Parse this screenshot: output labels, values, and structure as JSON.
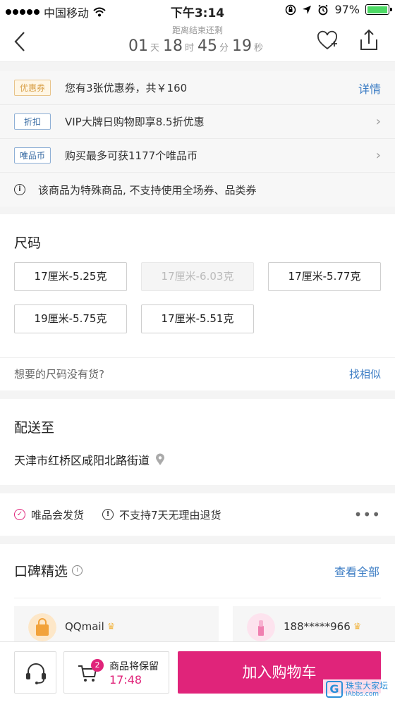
{
  "status_bar": {
    "carrier": "中国移动",
    "time": "下午3:14",
    "battery": "97%",
    "battery_level": 0.97
  },
  "nav": {
    "countdown_label": "距离结束还剩",
    "days": "01",
    "days_unit": "天",
    "hours": "18",
    "hours_unit": "时",
    "minutes": "45",
    "minutes_unit": "分",
    "seconds": "19",
    "seconds_unit": "秒"
  },
  "promotions": {
    "coupon_tag": "优惠券",
    "coupon_text": "您有3张优惠券，共￥160",
    "coupon_link": "详情",
    "discount_tag": "折扣",
    "discount_text": "VIP大牌日购物即享8.5折优惠",
    "coin_tag": "唯品币",
    "coin_text": "购买最多可获1177个唯品币",
    "notice_text": "该商品为特殊商品, 不支持使用全场券、品类券"
  },
  "size": {
    "title": "尺码",
    "options": [
      {
        "label": "17厘米-5.25克",
        "available": true
      },
      {
        "label": "17厘米-6.03克",
        "available": false
      },
      {
        "label": "17厘米-5.77克",
        "available": true
      },
      {
        "label": "19厘米-5.75克",
        "available": true
      },
      {
        "label": "17厘米-5.51克",
        "available": true
      }
    ],
    "want_text": "想要的尺码没有货?",
    "similar_link": "找相似"
  },
  "delivery": {
    "title": "配送至",
    "address": "天津市红桥区咸阳北路街道"
  },
  "service": {
    "ship_text": "唯品会发货",
    "return_text": "不支持7天无理由退货",
    "more": "•••"
  },
  "reviews": {
    "title": "口碑精选",
    "view_all": "查看全部",
    "users": [
      {
        "name": "QQmail"
      },
      {
        "name": "188*****966"
      }
    ]
  },
  "bottom": {
    "cart_count": "2",
    "keep_label": "商品将保留",
    "keep_time": "17:48",
    "add_to_cart": "加入购物车"
  },
  "watermark": {
    "text": "珠宝大家坛",
    "sub": "IAbbs.com"
  },
  "colors": {
    "accent": "#e0247a",
    "link": "#3b7cc4"
  }
}
